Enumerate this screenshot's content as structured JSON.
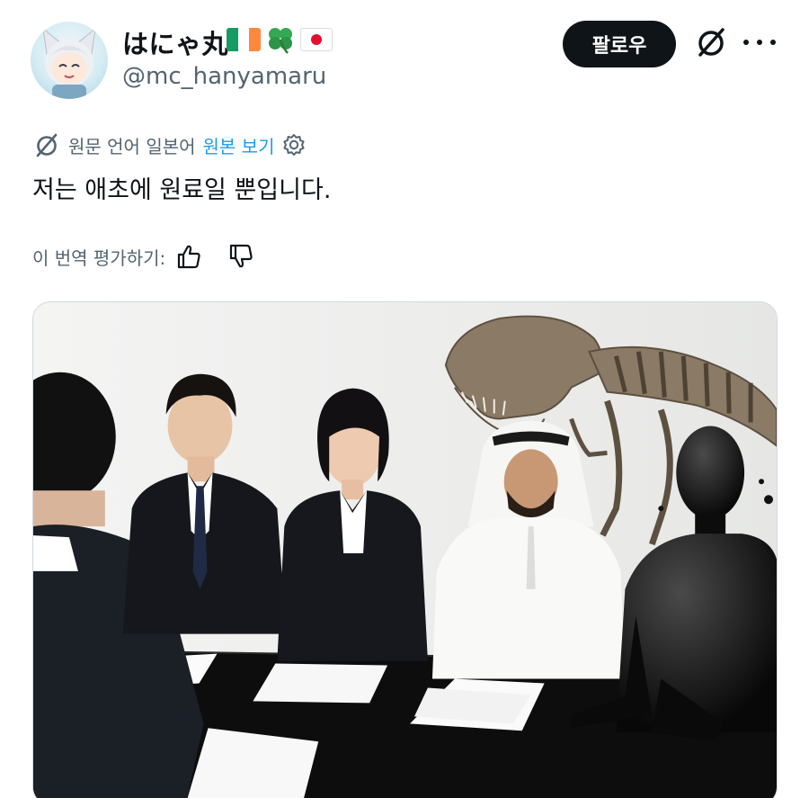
{
  "tweet": {
    "author": {
      "display_name": "はにゃ丸",
      "name_emoji": [
        "flag-ireland",
        "four-leaf-clover",
        "flag-japan"
      ],
      "handle": "@mc_hanyamaru"
    },
    "follow_label": "팔로우",
    "translation": {
      "source_language": "원문 언어 일본어",
      "show_original": "원본 보기",
      "text": "저는 애초에 원료일 뿐입니다.",
      "rate_prompt": "이 번역 평가하기:"
    },
    "media": {
      "description_icon": "photo"
    }
  },
  "colors": {
    "text_primary": "#0f1419",
    "text_secondary": "#536471",
    "link": "#1d9bf0",
    "follow_bg": "#0f1419"
  }
}
